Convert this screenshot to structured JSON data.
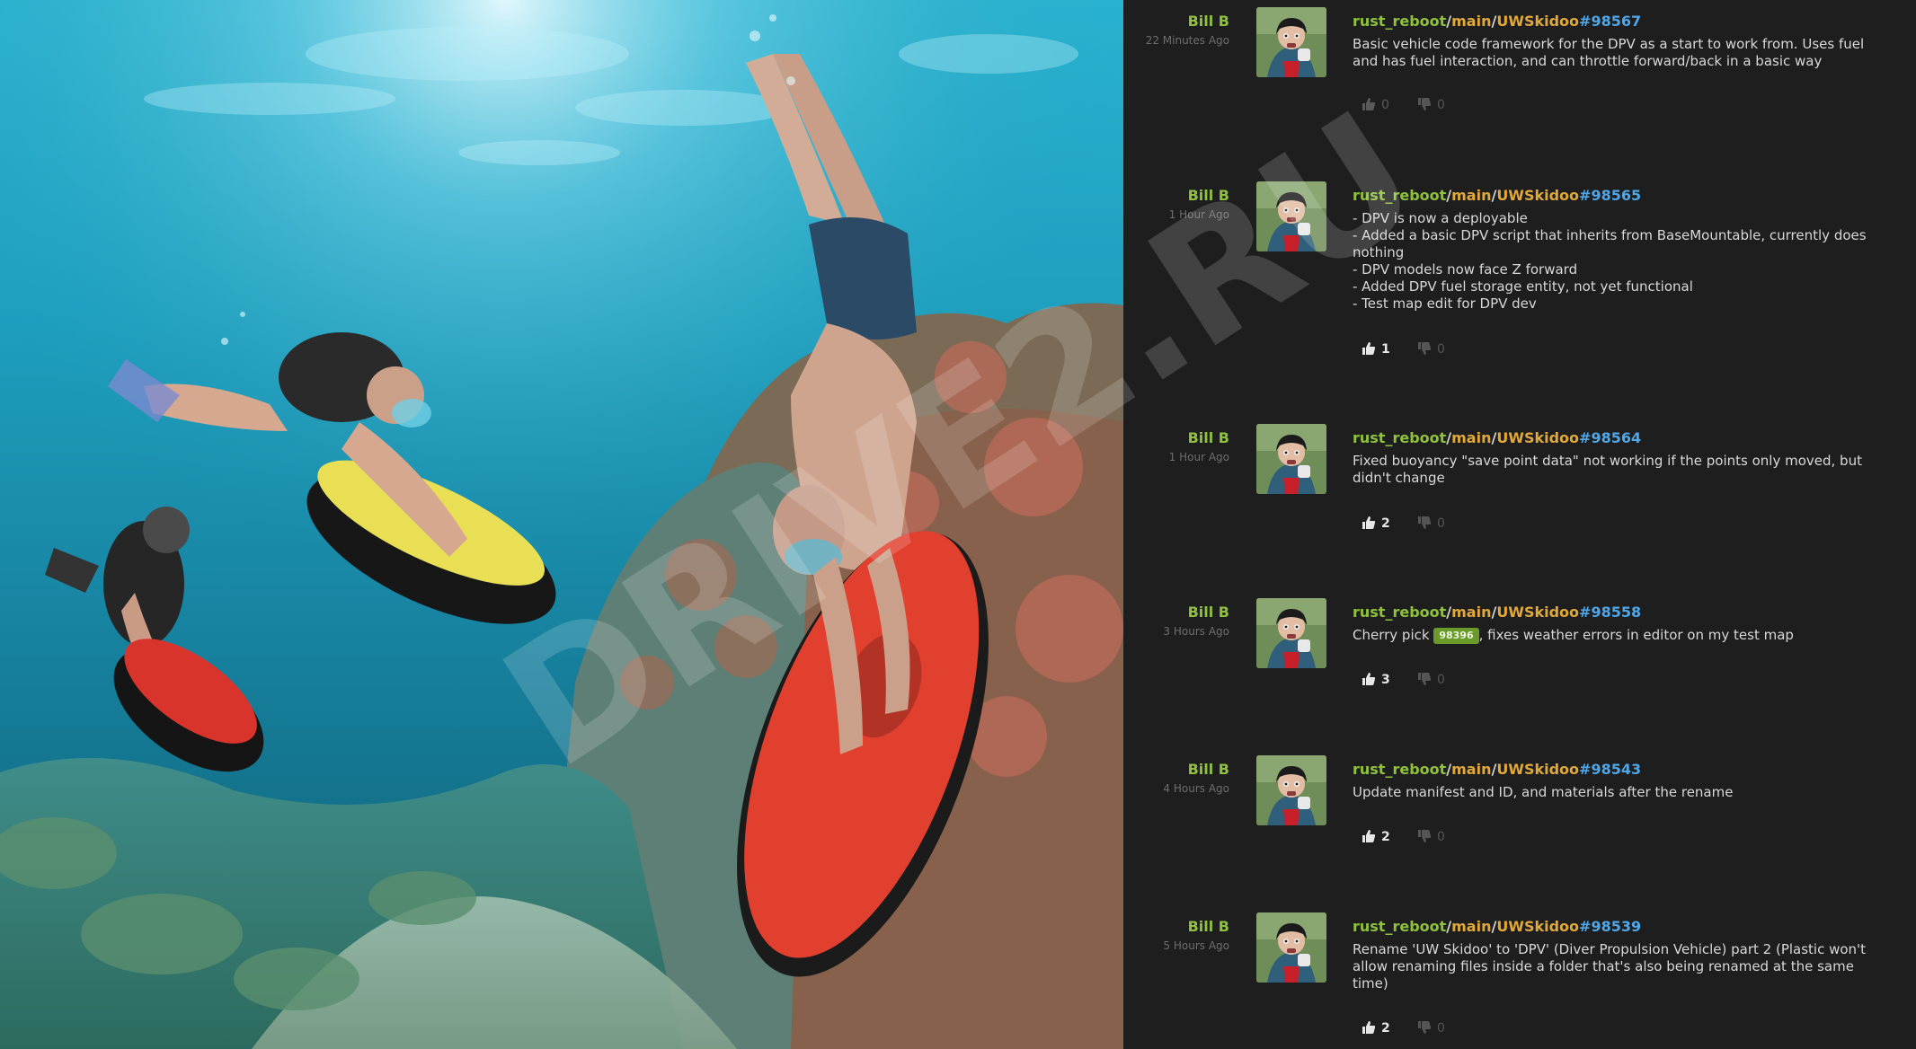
{
  "watermark": "DRIVE2.RU",
  "entries": [
    {
      "author": "Bill B",
      "time": "22 Minutes Ago",
      "repo": "rust_reboot",
      "branch": "main",
      "path": "UWSkidoo",
      "num": "#98567",
      "message": "Basic vehicle code framework for the DPV as a start to work from. Uses fuel and has fuel interaction, and can throttle forward/back in a basic way",
      "up": "0",
      "down": "0"
    },
    {
      "author": "Bill B",
      "time": "1 Hour Ago",
      "repo": "rust_reboot",
      "branch": "main",
      "path": "UWSkidoo",
      "num": "#98565",
      "message": "- DPV is now a deployable\n- Added a basic DPV script that inherits from BaseMountable, currently does nothing\n- DPV models now face Z forward\n- Added DPV fuel storage entity, not yet functional\n- Test map edit for DPV dev",
      "up": "1",
      "down": "0"
    },
    {
      "author": "Bill B",
      "time": "1 Hour Ago",
      "repo": "rust_reboot",
      "branch": "main",
      "path": "UWSkidoo",
      "num": "#98564",
      "message": "Fixed buoyancy \"save point data\" not working if the points only moved, but didn't change",
      "up": "2",
      "down": "0"
    },
    {
      "author": "Bill B",
      "time": "3 Hours Ago",
      "repo": "rust_reboot",
      "branch": "main",
      "path": "UWSkidoo",
      "num": "#98558",
      "message_prefix": "Cherry pick ",
      "tag": "98396",
      "message_suffix": ", fixes weather errors in editor on my test map",
      "up": "3",
      "down": "0"
    },
    {
      "author": "Bill B",
      "time": "4 Hours Ago",
      "repo": "rust_reboot",
      "branch": "main",
      "path": "UWSkidoo",
      "num": "#98543",
      "message": "Update manifest and ID, and materials after the rename",
      "up": "2",
      "down": "0"
    },
    {
      "author": "Bill B",
      "time": "5 Hours Ago",
      "repo": "rust_reboot",
      "branch": "main",
      "path": "UWSkidoo",
      "num": "#98539",
      "message": "Rename 'UW Skidoo' to 'DPV' (Diver Propulsion Vehicle) part 2 (Plastic won't allow renaming files inside a folder that's also being renamed at the same time)",
      "up": "2",
      "down": "0"
    }
  ],
  "icons": {
    "up": "thumbs-up-icon",
    "down": "thumbs-down-icon"
  },
  "colors": {
    "author": "#8fc13e",
    "branch": "#e0a93a",
    "commit_number": "#4ea7e8",
    "tag": "#6a9a2a",
    "feed_bg": "#1e1e1e"
  }
}
